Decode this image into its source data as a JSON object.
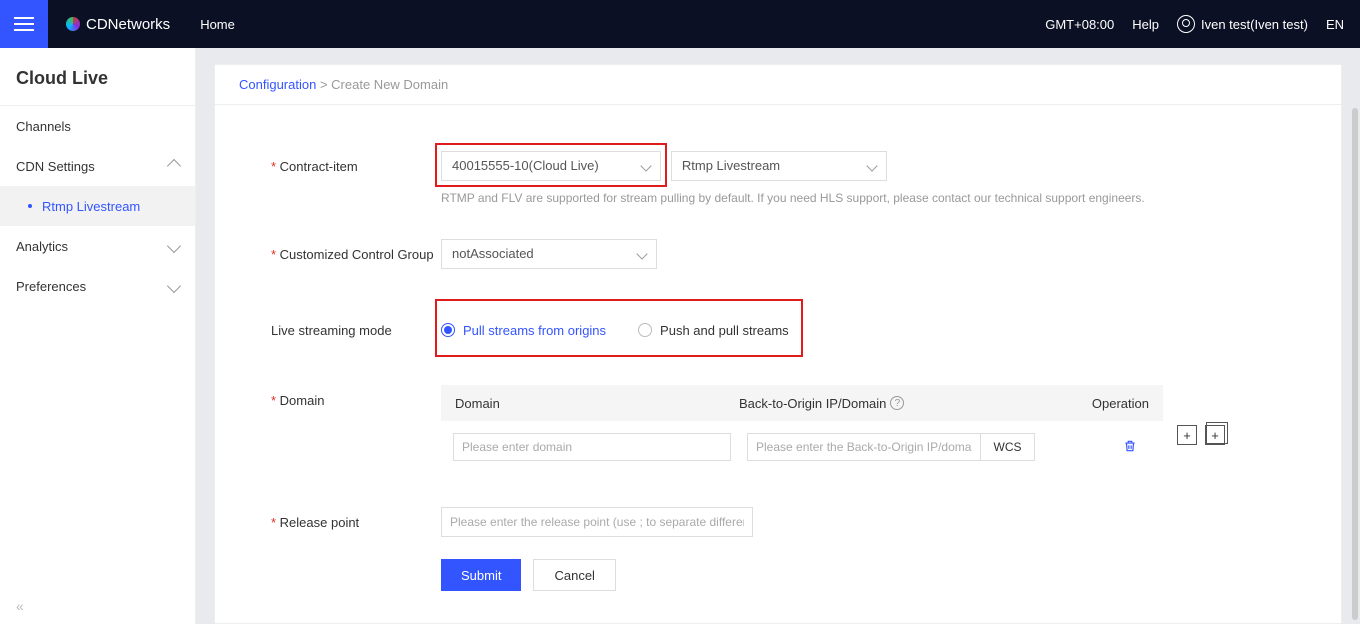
{
  "topbar": {
    "brand": "CDNetworks",
    "home": "Home",
    "timezone": "GMT+08:00",
    "help": "Help",
    "user": "Iven test(Iven test)",
    "lang": "EN"
  },
  "sidebar": {
    "title": "Cloud Live",
    "channels": "Channels",
    "cdn_settings": "CDN Settings",
    "rtmp": "Rtmp Livestream",
    "analytics": "Analytics",
    "preferences": "Preferences",
    "collapse": "«"
  },
  "breadcrumb": {
    "configuration": "Configuration",
    "sep": "  >  ",
    "current": "Create New Domain"
  },
  "form": {
    "contract_label": "Contract-item",
    "contract_value": "40015555-10(Cloud Live)",
    "stream_type_value": "Rtmp Livestream",
    "contract_hint": "RTMP and FLV are supported for stream pulling by default. If you need HLS support, please contact our technical support engineers.",
    "ccg_label": "Customized Control Group",
    "ccg_value": "notAssociated",
    "mode_label": "Live streaming mode",
    "mode_pull": "Pull streams from origins",
    "mode_push": "Push and pull streams",
    "domain_label": "Domain",
    "th_domain": "Domain",
    "th_origin": "Back-to-Origin IP/Domain",
    "th_op": "Operation",
    "ph_domain": "Please enter domain",
    "ph_origin": "Please enter the Back-to-Origin IP/domain",
    "wcs": "WCS",
    "rp_label": "Release point",
    "ph_rp": "Please enter the release point (use ; to separate different release points)",
    "submit": "Submit",
    "cancel": "Cancel",
    "plus": "+"
  }
}
